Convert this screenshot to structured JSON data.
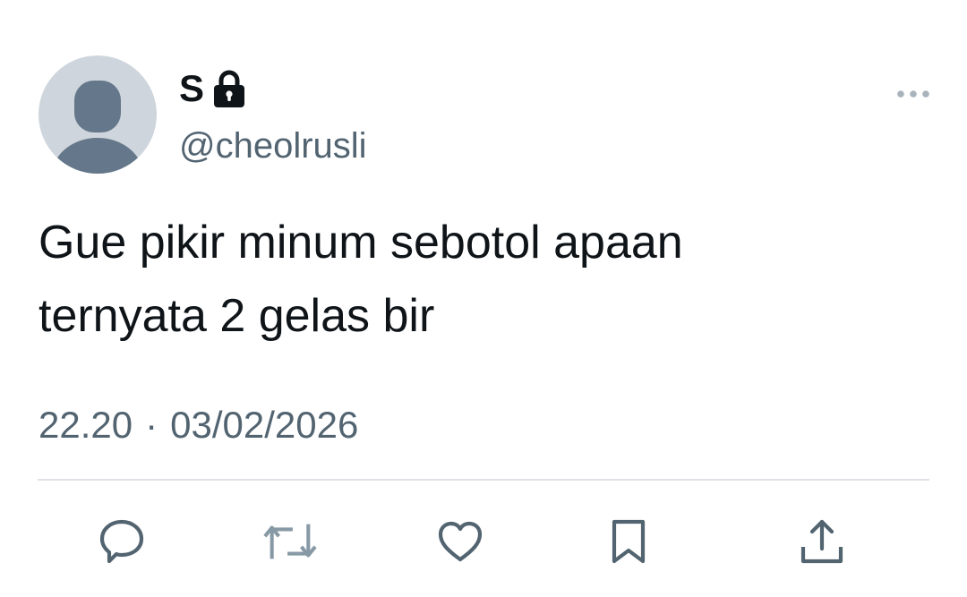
{
  "tweet": {
    "display_name": "S",
    "handle": "@cheolrusli",
    "text": "Gue pikir minum sebotol apaan\nternyata 2 gelas bir",
    "time": "22.20",
    "separator": "·",
    "date": "03/02/2026"
  },
  "icons": {
    "lock": "lock-icon",
    "more": "more-horizontal-icon",
    "reply": "reply-icon",
    "retweet": "retweet-icon",
    "like": "heart-icon",
    "bookmark": "bookmark-icon",
    "share": "share-icon"
  },
  "colors": {
    "text_primary": "#0f1419",
    "text_secondary": "#536471",
    "avatar_bg": "#ced5dc",
    "avatar_figure": "#65778a",
    "divider": "#dfe3e7",
    "icon": "#536471",
    "icon_retweet": "#8899a6"
  }
}
